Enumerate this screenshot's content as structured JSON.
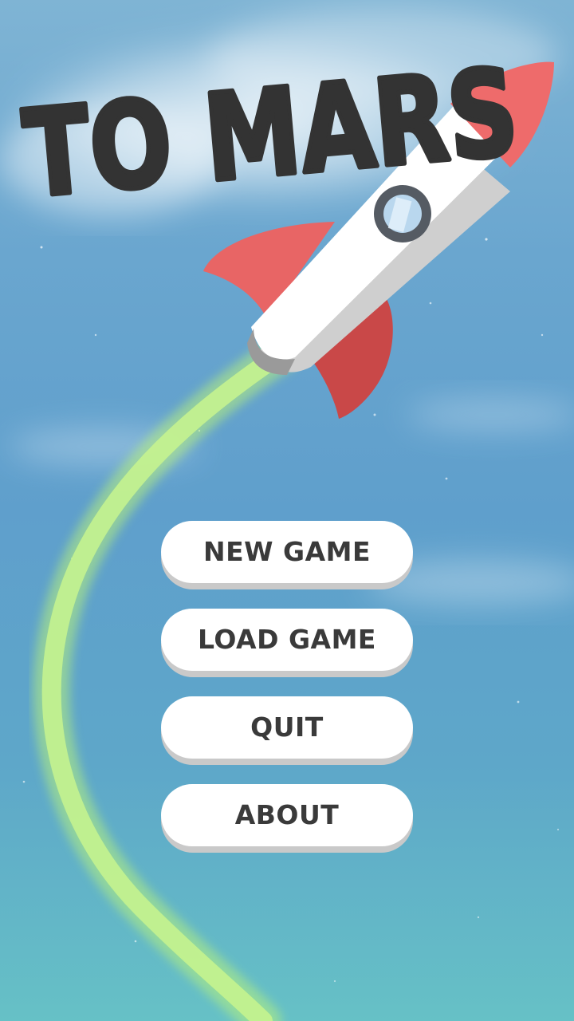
{
  "game": {
    "title": "TO MARS"
  },
  "menu": {
    "items": [
      {
        "id": "new-game",
        "label": "NEW GAME"
      },
      {
        "id": "load-game",
        "label": "LOAD GAME"
      },
      {
        "id": "quit",
        "label": "QUIT"
      },
      {
        "id": "about",
        "label": "ABOUT"
      }
    ]
  },
  "colors": {
    "sky": "#6aa6cf",
    "title_text": "#333333",
    "rocket_body": "#ffffff",
    "rocket_fin": "#e06060",
    "rocket_nose": "#ee6b6b",
    "exhaust_trail": "#b8f27a",
    "button_face": "#ffffff",
    "button_text": "#3a3a3a"
  },
  "icons": {
    "rocket": "rocket-icon",
    "trail": "exhaust-trail"
  }
}
